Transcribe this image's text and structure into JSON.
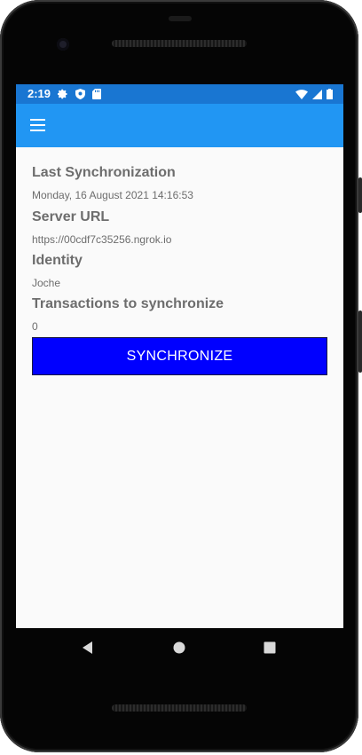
{
  "status_bar": {
    "time": "2:19",
    "left_icons": [
      "settings-icon",
      "shield-icon",
      "sd-card-icon"
    ],
    "right_icons": [
      "wifi-icon",
      "signal-icon",
      "battery-icon"
    ]
  },
  "app_bar": {
    "menu_icon": "hamburger-menu-icon",
    "background_color": "#2196f3",
    "status_color": "#1976d2"
  },
  "sync_info": {
    "last_sync_label": "Last Synchronization",
    "last_sync_value": "Monday, 16 August 2021 14:16:53",
    "server_url_label": "Server URL",
    "server_url_value": "https://00cdf7c35256.ngrok.io",
    "identity_label": "Identity",
    "identity_value": "Joche",
    "transactions_label": "Transactions to synchronize",
    "transactions_value": "0"
  },
  "actions": {
    "synchronize_label": "SYNCHRONIZE",
    "button_color": "#0000ff"
  },
  "nav_bar": {
    "back_icon": "back-triangle-icon",
    "home_icon": "home-circle-icon",
    "recents_icon": "recents-square-icon"
  }
}
